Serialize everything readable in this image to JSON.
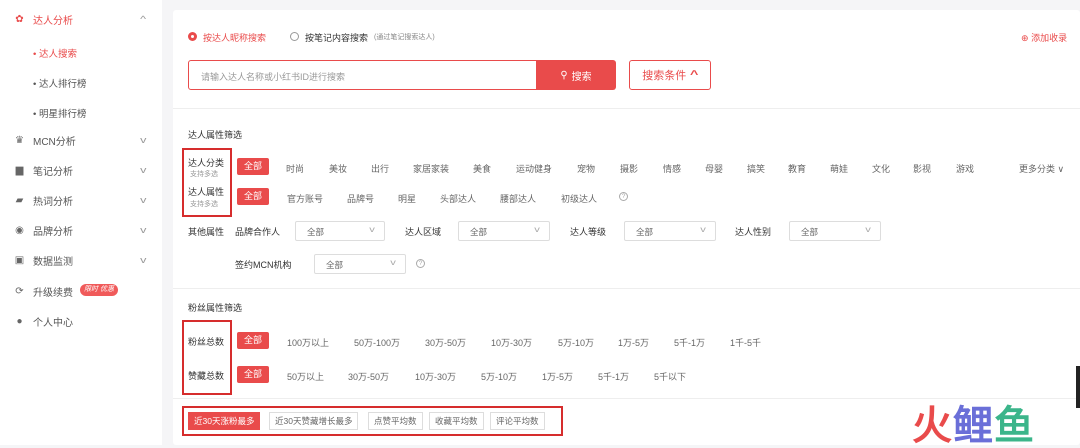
{
  "sidebar": {
    "items": [
      {
        "label": "达人分析",
        "icon": "gear-icon",
        "expanded": true
      },
      {
        "label": "MCN分析",
        "icon": "crown-icon"
      },
      {
        "label": "笔记分析",
        "icon": "note-icon"
      },
      {
        "label": "热词分析",
        "icon": "message-icon"
      },
      {
        "label": "品牌分析",
        "icon": "brand-icon"
      },
      {
        "label": "数据监测",
        "icon": "monitor-icon"
      },
      {
        "label": "升级续费",
        "icon": "upgrade-icon"
      },
      {
        "label": "个人中心",
        "icon": "user-icon"
      }
    ],
    "sub_items": [
      "• 达人搜索",
      "• 达人排行榜",
      "• 明星排行榜"
    ],
    "upgrade_badge": "限时 优惠"
  },
  "search": {
    "mode1": "按达人昵称搜索",
    "mode2": "按笔记内容搜索",
    "mode2_note": "(通过笔记搜索达人)",
    "add_collect": "添加收录",
    "placeholder": "请输入达人名称或小红书ID进行搜索",
    "button": "搜索",
    "conditions": "搜索条件"
  },
  "influencer_filter": {
    "title": "达人属性筛选",
    "category_label": "达人分类",
    "category_sub": "支持多选",
    "categories": [
      "全部",
      "时尚",
      "美妆",
      "出行",
      "家居家装",
      "美食",
      "运动健身",
      "宠物",
      "摄影",
      "情感",
      "母婴",
      "搞笑",
      "教育",
      "萌娃",
      "文化",
      "影视",
      "游戏"
    ],
    "more_categories": "更多分类",
    "attr_label": "达人属性",
    "attr_sub": "支持多选",
    "attrs": [
      "全部",
      "官方账号",
      "品牌号",
      "明星",
      "头部达人",
      "腰部达人",
      "初级达人"
    ],
    "other_label": "其他属性",
    "brand_partner": "品牌合作人",
    "region": "达人区域",
    "level": "达人等级",
    "gender": "达人性别",
    "mcn": "签约MCN机构",
    "select_default": "全部"
  },
  "fans_filter": {
    "title": "粉丝属性筛选",
    "fans_label": "粉丝总数",
    "fans_options": [
      "全部",
      "100万以上",
      "50万-100万",
      "30万-50万",
      "10万-30万",
      "5万-10万",
      "1万-5万",
      "5千-1万",
      "1千-5千"
    ],
    "likes_label": "赞藏总数",
    "likes_options": [
      "全部",
      "50万以上",
      "30万-50万",
      "10万-30万",
      "5万-10万",
      "1万-5万",
      "5千-1万",
      "5千以下"
    ]
  },
  "sort_tabs": [
    "近30天涨粉最多",
    "近30天赞藏增长最多",
    "点赞平均数",
    "收藏平均数",
    "评论平均数"
  ],
  "watermark": {
    "part1": "火",
    "part2": "鲤",
    "part3": "鱼"
  },
  "colors": {
    "accent": "#e94b4b",
    "frame": "#d62d2d"
  }
}
